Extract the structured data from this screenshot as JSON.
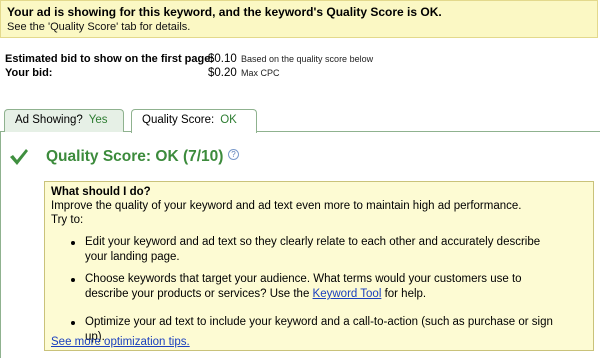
{
  "banner": {
    "title": "Your ad is showing for this keyword, and the keyword's Quality Score is OK.",
    "subtitle": "See the 'Quality Score' tab for details."
  },
  "bids": {
    "first_page": {
      "label": "Estimated bid to show on the first page:",
      "value": "$0.10",
      "note": "Based on the quality score below"
    },
    "your_bid": {
      "label": "Your bid:",
      "value": "$0.20",
      "note": "Max CPC"
    }
  },
  "tabs": [
    {
      "label": "Ad Showing?",
      "value": "Yes",
      "active": false
    },
    {
      "label": "Quality Score:",
      "value": "OK",
      "active": true
    }
  ],
  "quality": {
    "title": "Quality Score: OK (7/10)",
    "help_glyph": "?"
  },
  "tips": {
    "heading": "What should I do?",
    "intro_1": "Improve the quality of your keyword and ad text even more to maintain high ad performance.",
    "intro_2": "Try to:",
    "items": [
      {
        "text": "Edit your keyword and ad text so they clearly relate to each other and accurately describe your landing page."
      },
      {
        "text_before": "Choose keywords that target your audience. What terms would your customers use to describe your products or services? Use the ",
        "link": "Keyword Tool",
        "text_after": " for help."
      },
      {
        "text": "Optimize your ad text to include your keyword and a call-to-action (such as purchase or sign up)."
      }
    ],
    "more_link": "See more optimization tips."
  },
  "colors": {
    "banner_bg": "#fbf8c4",
    "accent_green": "#3c8b3c",
    "link_blue": "#1a3fbf",
    "tips_bg": "#fdfbd3"
  },
  "icons": {
    "status": "checkmark-icon",
    "help": "help-icon",
    "bullet": "bullet-icon"
  }
}
